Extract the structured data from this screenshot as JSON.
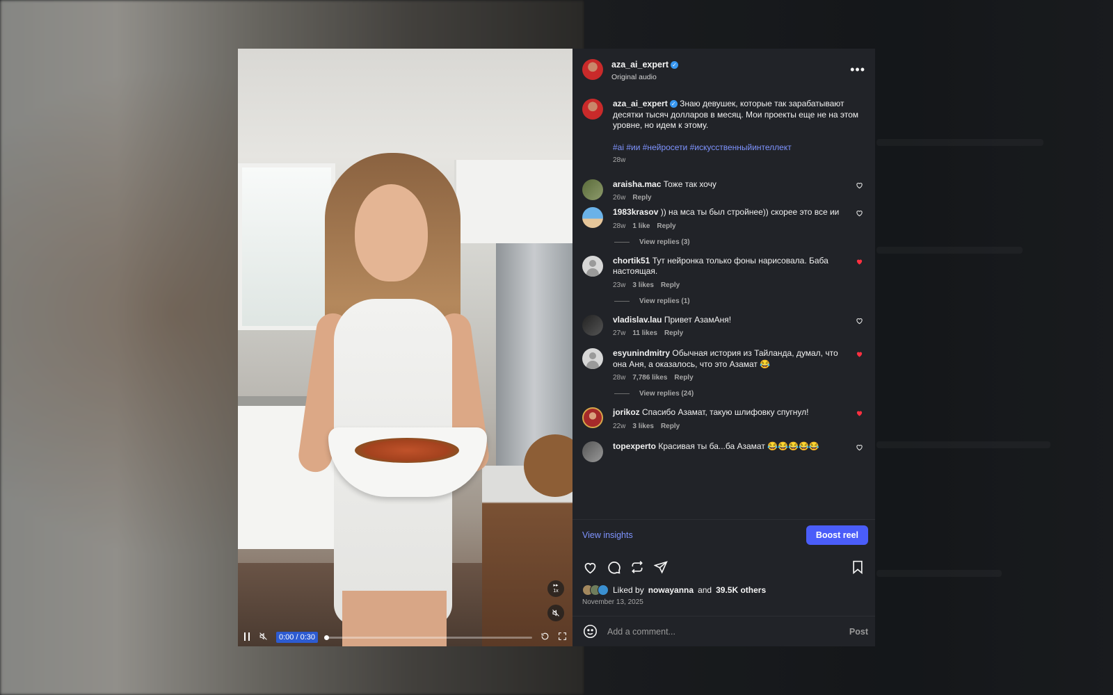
{
  "colors": {
    "panel_bg": "#212328",
    "link_blue": "#7f94ff",
    "boost_blue": "#4a5df9",
    "heart_red": "#ff3040",
    "time_badge": "#2d5bd1"
  },
  "header": {
    "username": "aza_ai_expert",
    "verified": true,
    "audio_label": "Original audio",
    "more_icon": "more-horizontal-icon"
  },
  "caption": {
    "username": "aza_ai_expert",
    "text": "Знаю девушек, которые так зарабатывают десятки тысяч долларов в месяц. Мои проекты еще не на этом уровне, но идем к этому.",
    "hashtags": "#ai #ии #нейросети #искусственныйинтеллект",
    "time": "28w"
  },
  "comments": [
    {
      "username": "araisha.mac",
      "text": "Тоже так хочу",
      "time": "26w",
      "likes": "",
      "reply": "Reply",
      "liked": false,
      "view_replies": ""
    },
    {
      "username": "1983krasov",
      "text": ")) на мса ты был стройнее)) скорее это все ии",
      "time": "28w",
      "likes": "1 like",
      "reply": "Reply",
      "liked": false,
      "view_replies": "View replies (3)"
    },
    {
      "username": "chortik51",
      "text": "Тут нейронка только фоны нарисовала. Баба настоящая.",
      "time": "23w",
      "likes": "3 likes",
      "reply": "Reply",
      "liked": true,
      "view_replies": "View replies (1)"
    },
    {
      "username": "vladislav.lau",
      "text": "Привет АзамАня!",
      "time": "27w",
      "likes": "11 likes",
      "reply": "Reply",
      "liked": false,
      "view_replies": ""
    },
    {
      "username": "esyunindmitry",
      "text": "Обычная история из Тайланда, думал, что она Аня, а оказалось, что это Азамат 😂",
      "time": "28w",
      "likes": "7,786 likes",
      "reply": "Reply",
      "liked": true,
      "view_replies": "View replies (24)"
    },
    {
      "username": "jorikoz",
      "text": "Спасибо Азамат, такую шлифовку спугнул!",
      "time": "22w",
      "likes": "3 likes",
      "reply": "Reply",
      "liked": true,
      "view_replies": ""
    },
    {
      "username": "topexperto",
      "text": "Красивая ты ба...ба Азамат 😂😂😂😂😂",
      "time": "",
      "likes": "",
      "reply": "",
      "liked": false,
      "view_replies": ""
    }
  ],
  "insights": {
    "view_label": "View insights",
    "boost_label": "Boost reel"
  },
  "actions": {
    "like_icon": "heart-icon",
    "comment_icon": "comment-icon",
    "repost_icon": "repost-icon",
    "share_icon": "send-icon",
    "save_icon": "bookmark-icon"
  },
  "likes": {
    "prefix": "Liked by",
    "user": "nowayanna",
    "joiner": "and",
    "others": "39.5K others"
  },
  "date": "November 13, 2025",
  "comment_box": {
    "placeholder": "Add a comment...",
    "post_label": "Post"
  },
  "video": {
    "time_display": "0:00 / 0:30",
    "progress": 0.0,
    "speed_label": "1x"
  }
}
